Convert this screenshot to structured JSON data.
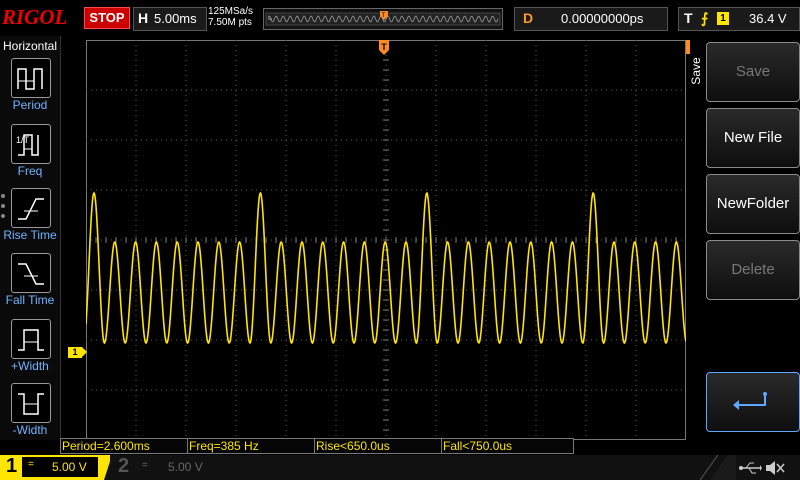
{
  "brand": "RIGOL",
  "run_state": "STOP",
  "horizontal": {
    "label": "H",
    "timebase": "5.00ms"
  },
  "acquisition": {
    "sample_rate": "125MSa/s",
    "memory_points": "7.50M pts"
  },
  "delay": {
    "label": "D",
    "value": "0.00000000ps"
  },
  "trigger": {
    "label": "T",
    "source": "1",
    "level": "36.4 V",
    "edge_color": "#ffe500"
  },
  "left_menu": {
    "title": "Horizontal",
    "items": [
      {
        "label": "Period",
        "icon": "period-icon"
      },
      {
        "label": "Freq",
        "icon": "freq-icon"
      },
      {
        "label": "Rise Time",
        "icon": "rise-time-icon"
      },
      {
        "label": "Fall Time",
        "icon": "fall-time-icon"
      },
      {
        "label": "+Width",
        "icon": "positive-width-icon"
      },
      {
        "label": "-Width",
        "icon": "negative-width-icon"
      }
    ]
  },
  "right_menu": {
    "tab": "Save",
    "buttons": [
      {
        "label": "Save",
        "enabled": false
      },
      {
        "label": "New File",
        "enabled": true
      },
      {
        "label": "NewFolder",
        "enabled": true
      },
      {
        "label": "Delete",
        "enabled": false
      }
    ],
    "return_icon": "return-arrow-icon"
  },
  "measurements": [
    {
      "text": "Period=2.600ms"
    },
    {
      "text": "Freq=385 Hz"
    },
    {
      "text": "Rise<650.0us"
    },
    {
      "text": "Fall<750.0us"
    }
  ],
  "channels": [
    {
      "number": "1",
      "coupling": "=",
      "scale": "5.00 V",
      "active": true,
      "color": "#ffe500"
    },
    {
      "number": "2",
      "coupling": "=",
      "scale": "5.00 V",
      "active": false,
      "color": "#555555"
    }
  ],
  "ch1_marker": "1",
  "colors": {
    "waveform": "#ffe500",
    "grid": "#5a5a5a",
    "accent": "#5ea8ff",
    "stop": "#cc0000"
  },
  "status_icons": [
    "usb-icon",
    "speaker-muted-icon"
  ]
}
